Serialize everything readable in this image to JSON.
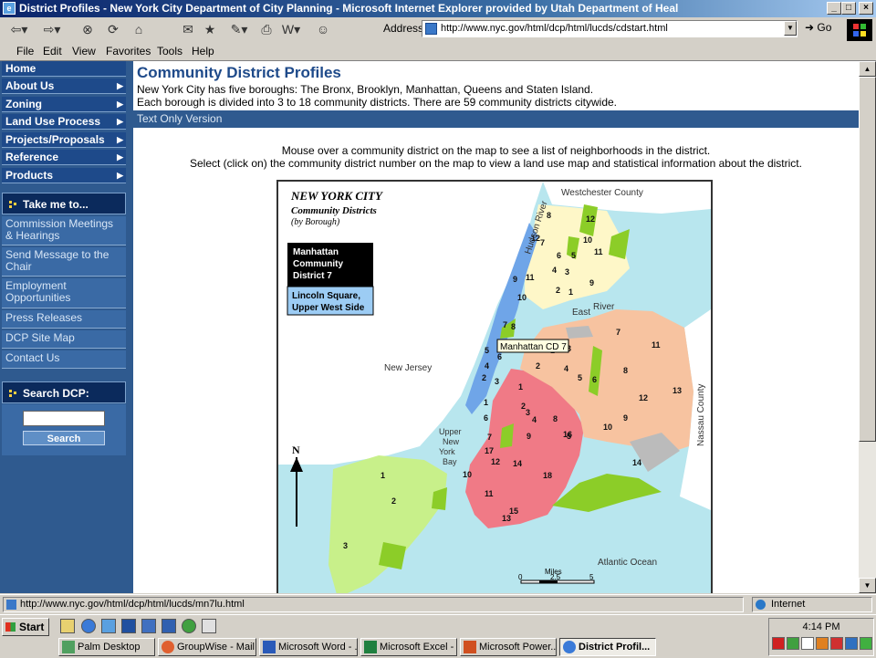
{
  "window": {
    "title": "District Profiles - New York City Department of City Planning - Microsoft Internet Explorer provided by Utah Department of Heal"
  },
  "toolbar": {
    "address_label": "Address",
    "address_url": "http://www.nyc.gov/html/dcp/html/lucds/cdstart.html",
    "go_label": "Go"
  },
  "menu": [
    "File",
    "Edit",
    "View",
    "Favorites",
    "Tools",
    "Help"
  ],
  "sidebar": {
    "nav": [
      {
        "label": "Home",
        "arrow": false
      },
      {
        "label": "About Us",
        "arrow": true
      },
      {
        "label": "Zoning",
        "arrow": true
      },
      {
        "label": "Land Use Process",
        "arrow": true
      },
      {
        "label": "Projects/Proposals",
        "arrow": true
      },
      {
        "label": "Reference",
        "arrow": true
      },
      {
        "label": "Products",
        "arrow": true
      }
    ],
    "take_me_heading": "Take me to...",
    "take_me_links": [
      "Commission Meetings & Hearings",
      "Send Message to the Chair",
      "Employment Opportunities",
      "Press Releases",
      "DCP Site Map",
      "Contact Us"
    ],
    "search_heading": "Search DCP:",
    "search_button": "Search"
  },
  "main": {
    "heading": "Community District Profiles",
    "intro_line1": "New York City has five boroughs: The Bronx, Brooklyn, Manhattan, Queens and Staten Island.",
    "intro_line2": "Each borough is divided into 3 to 18 community districts. There are 59 community districts citywide.",
    "text_only_link": "Text Only Version",
    "instruction_line1": "Mouse over a community district on the map to see a list of neighborhoods in the district.",
    "instruction_line2": "Select (click on) the community district number on the map to view a land use map and statistical information about the district."
  },
  "map": {
    "title_line1": "NEW YORK CITY",
    "title_line2": "Community Districts",
    "title_line3": "(by Borough)",
    "info_box_title": [
      "Manhattan",
      "Community",
      "District 7"
    ],
    "info_box_neighborhoods": [
      "Lincoln Square,",
      "Upper West Side"
    ],
    "tooltip": "Manhattan CD 7",
    "labels": {
      "westchester": "Westchester County",
      "hudson": "Hudson River",
      "new_jersey": "New Jersey",
      "river": "River",
      "east": "East",
      "upper_ny_bay": [
        "Upper",
        "New",
        "York",
        "Bay"
      ],
      "nassau": "Nassau County",
      "atlantic": "Atlantic Ocean",
      "north": "N",
      "miles": "Miles",
      "scale": [
        "0",
        "2.5",
        "5"
      ]
    },
    "colors": {
      "water": "#b8e6ee",
      "land": "#ffffff",
      "bronx": "#fef7c8",
      "manhattan": "#6fa5e8",
      "brooklyn": "#f07a86",
      "queens": "#f7c3a0",
      "staten_island": "#c8f08a",
      "parks": "#8ccd28"
    },
    "district_numbers": {
      "bronx": [
        "8",
        "12",
        "7",
        "5",
        "6",
        "11",
        "10",
        "4",
        "3",
        "2",
        "9",
        "1"
      ],
      "manhattan": [
        "12",
        "11",
        "9",
        "10",
        "7",
        "8",
        "6",
        "5",
        "4",
        "2",
        "3",
        "1"
      ],
      "queens": [
        "7",
        "11",
        "1",
        "3",
        "2",
        "4",
        "8",
        "5",
        "6",
        "12",
        "13",
        "9",
        "10",
        "14"
      ],
      "brooklyn": [
        "1",
        "3",
        "4",
        "2",
        "8",
        "16",
        "6",
        "7",
        "9",
        "5",
        "17",
        "12",
        "14",
        "18",
        "10",
        "11",
        "15",
        "13"
      ],
      "staten_island": [
        "1",
        "2",
        "3"
      ]
    }
  },
  "status": {
    "url": "http://www.nyc.gov/html/dcp/html/lucds/mn7lu.html",
    "zone": "Internet"
  },
  "taskbar": {
    "start_label": "Start",
    "tasks": [
      "Palm Desktop",
      "GroupWise - Mail...",
      "Microsoft Word - ...",
      "Microsoft Excel - ...",
      "Microsoft Power...",
      "District Profil..."
    ],
    "clock": "4:14 PM"
  }
}
